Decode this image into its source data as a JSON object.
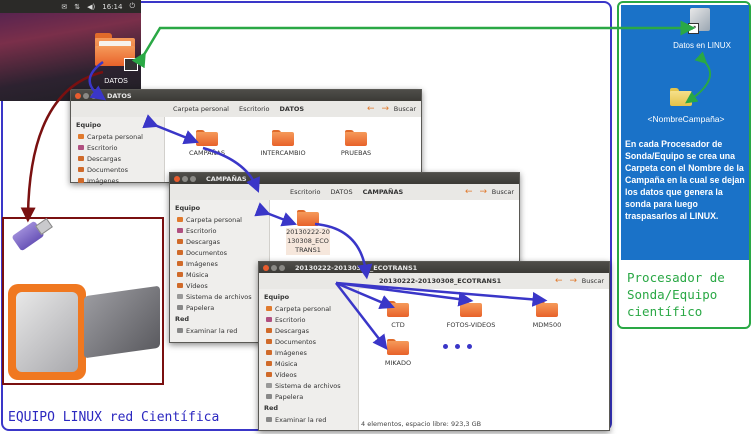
{
  "desktop": {
    "clock": "16:14",
    "folder_label": "DATOS"
  },
  "win1": {
    "title": "DATOS",
    "crumbs": [
      "Carpeta personal",
      "Escritorio",
      "DATOS"
    ],
    "search": "Buscar",
    "folders": [
      "CAMPAÑAS",
      "INTERCAMBIO",
      "PRUEBAS"
    ]
  },
  "win2": {
    "title": "CAMPAÑAS",
    "crumbs": [
      "Escritorio",
      "DATOS",
      "CAMPAÑAS"
    ],
    "search": "Buscar",
    "folder": "20130222-20130308_ECOTRANS1"
  },
  "win3": {
    "title": "20130222-20130308_ECOTRANS1",
    "crumb": "20130222-20130308_ECOTRANS1",
    "search": "Buscar",
    "folders": [
      "CTD",
      "FOTOS-VIDEOS",
      "MDM500",
      "MIKADO"
    ],
    "status": "4 elementos, espacio libre: 923,3 GB"
  },
  "sidebar": {
    "equipo": "Equipo",
    "items": [
      "Carpeta personal",
      "Escritorio",
      "Descargas",
      "Documentos",
      "Imágenes",
      "Música",
      "Vídeos",
      "Sistema de archivos",
      "Papelera"
    ],
    "red": "Red",
    "network": "Examinar la red"
  },
  "windows_panel": {
    "shortcut_label": "Datos en LINUX",
    "folder_label": "<NombreCampaña>",
    "description": "En cada Procesador de Sonda/Equipo se crea una Carpeta con el Nombre de la Campaña en la cual se dejan los datos que genera la sonda para luego traspasarlos al LINUX."
  },
  "labels": {
    "linux": "EQUIPO LINUX red Científica",
    "processor": "Procesador de\nSonda/Equipo\ncientífico"
  },
  "colors": {
    "linux_frame": "#3a36c8",
    "science_frame": "#2aa845",
    "usb_frame": "#7a1010",
    "folder_orange": "#f08a4a",
    "panel_blue": "#1a72c8"
  }
}
